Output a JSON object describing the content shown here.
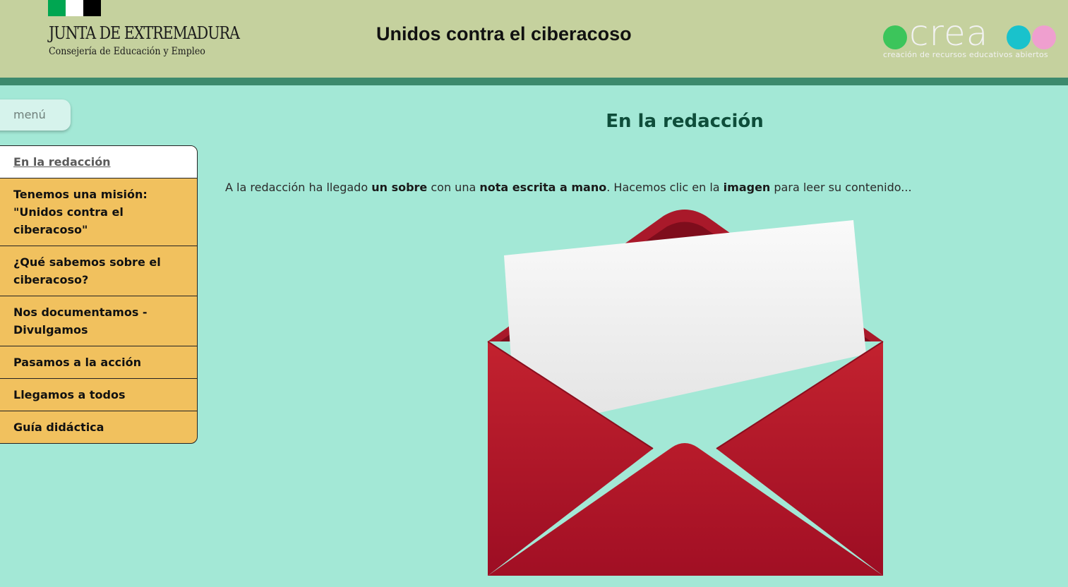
{
  "header": {
    "junta_name": "JUNTA DE EXTREMADURA",
    "junta_sub": "Consejería de Educación y Empleo",
    "site_title": "Unidos contra el ciberacoso",
    "crea_word": "crea",
    "crea_tagline": "creación de recursos educativos abiertos",
    "flag_colors": [
      "#00a651",
      "#ffffff",
      "#000000"
    ],
    "crea_dot_colors": [
      "#3cc55b",
      "#19c2cc",
      "#ef9fcf"
    ]
  },
  "menu": {
    "toggle_label": "menú",
    "items": [
      {
        "label": "En la redacción",
        "active": true
      },
      {
        "label": "Tenemos una misión: \"Unidos contra el ciberacoso\"",
        "active": false
      },
      {
        "label": "¿Qué sabemos sobre el ciberacoso?",
        "active": false
      },
      {
        "label": "Nos documentamos - Divulgamos",
        "active": false
      },
      {
        "label": "Pasamos a la acción",
        "active": false
      },
      {
        "label": "Llegamos a todos",
        "active": false
      },
      {
        "label": "Guía didáctica",
        "active": false
      }
    ]
  },
  "main": {
    "heading": "En la redacción",
    "intro": {
      "t1": "A la redacción ha llegado ",
      "b1": "un sobre",
      "t2": " con una ",
      "b2": "nota escrita a mano",
      "t3": ". Hacemos clic en la ",
      "b3": "imagen",
      "t4": " para leer su contenido..."
    },
    "image_icon": "envelope-with-letter-icon"
  },
  "colors": {
    "header_bg": "#c5d19e",
    "header_band": "#3c8a6d",
    "page_bg": "#a3e8d6",
    "menu_item_bg": "#f1c15e",
    "heading": "#0e4d3a",
    "envelope": "#b01c2e"
  }
}
